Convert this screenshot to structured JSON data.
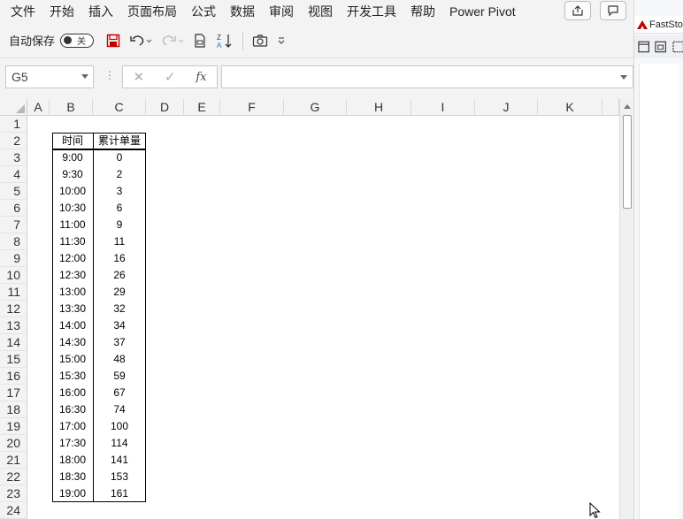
{
  "menu": [
    "文件",
    "开始",
    "插入",
    "页面布局",
    "公式",
    "数据",
    "审阅",
    "视图",
    "开发工具",
    "帮助",
    "Power Pivot"
  ],
  "qat": {
    "autosave_label": "自动保存",
    "autosave_state": "关"
  },
  "side_panel": {
    "title": "FastSto"
  },
  "formula_bar": {
    "name_box": "G5",
    "fx": "fx",
    "formula": ""
  },
  "columns": [
    "A",
    "B",
    "C",
    "D",
    "E",
    "F",
    "G",
    "H",
    "I",
    "J",
    "K"
  ],
  "rows": [
    "1",
    "2",
    "3",
    "4",
    "5",
    "6",
    "7",
    "8",
    "9",
    "10",
    "11",
    "12",
    "13",
    "14",
    "15",
    "16",
    "17",
    "18",
    "19",
    "20",
    "21",
    "22",
    "23",
    "24"
  ],
  "table": {
    "headers": [
      "时间",
      "累计单量"
    ],
    "rows": [
      [
        "9:00",
        "0"
      ],
      [
        "9:30",
        "2"
      ],
      [
        "10:00",
        "3"
      ],
      [
        "10:30",
        "6"
      ],
      [
        "11:00",
        "9"
      ],
      [
        "11:30",
        "11"
      ],
      [
        "12:00",
        "16"
      ],
      [
        "12:30",
        "26"
      ],
      [
        "13:00",
        "29"
      ],
      [
        "13:30",
        "32"
      ],
      [
        "14:00",
        "34"
      ],
      [
        "14:30",
        "37"
      ],
      [
        "15:00",
        "48"
      ],
      [
        "15:30",
        "59"
      ],
      [
        "16:00",
        "67"
      ],
      [
        "16:30",
        "74"
      ],
      [
        "17:00",
        "100"
      ],
      [
        "17:30",
        "114"
      ],
      [
        "18:00",
        "141"
      ],
      [
        "18:30",
        "153"
      ],
      [
        "19:00",
        "161"
      ]
    ]
  },
  "colors": {
    "accent": "#c00000",
    "chrome": "#f3f3f3"
  }
}
